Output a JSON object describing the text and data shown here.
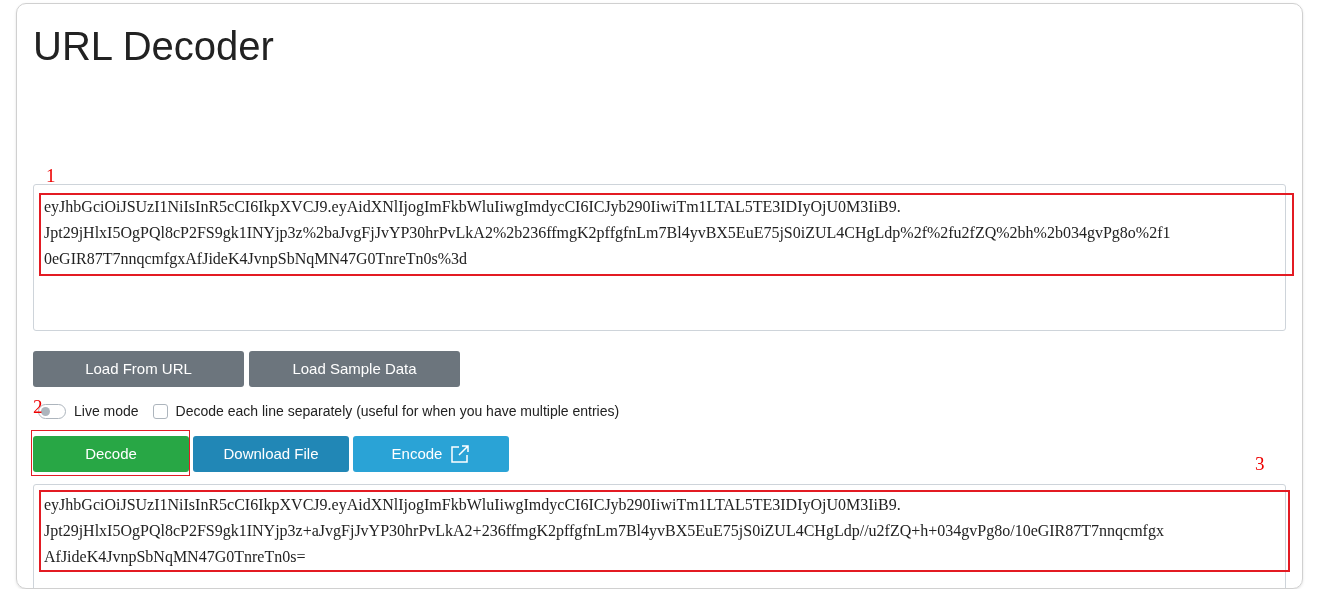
{
  "title": "URL Decoder",
  "input": {
    "lines": [
      "eyJhbGciOiJSUzI1NiIsInR5cCI6IkpXVCJ9.eyAidXNlIjogImFkbWluIiwgImdycCI6ICJyb290IiwiTm1LTAL5TE3IDIyOjU0M3IiB9.",
      "Jpt29jHlxI5OgPQl8cP2FS9gk1INYjp3z%2baJvgFjJvYP30hrPvLkA2%2b236ffmgK2pffgfnLm7Bl4yvBX5EuE75jS0iZUL4CHgLdp%2f%2fu2fZQ%2bh%2b034gvPg8o%2f1",
      "0eGIR87T7nnqcmfgxAfJideK4JvnpSbNqMN47G0TnreTn0s%3d"
    ],
    "annotation": "1"
  },
  "load_buttons": [
    "Load From URL",
    "Load Sample Data"
  ],
  "options": [
    {
      "kind": "toggle",
      "label": "Live mode",
      "on": false,
      "annotation": "2"
    },
    {
      "kind": "checkbox",
      "label": "Decode each line separately (useful for when you have multiple entries)",
      "checked": false
    }
  ],
  "action_buttons": [
    {
      "kind": "decode",
      "label": "Decode",
      "annotated": true
    },
    {
      "kind": "download",
      "label": "Download File",
      "annotated": false
    },
    {
      "kind": "encode",
      "label": "Encode",
      "annotated": false
    }
  ],
  "output": {
    "lines": [
      "eyJhbGciOiJSUzI1NiIsInR5cCI6IkpXVCJ9.eyAidXNlIjogImFkbWluIiwgImdycCI6ICJyb290IiwiTm1LTAL5TE3IDIyOjU0M3IiB9.",
      "Jpt29jHlxI5OgPQl8cP2FS9gk1INYjp3z+aJvgFjJvYP30hrPvLkA2+236ffmgK2pffgfnLm7Bl4yvBX5EuE75jS0iZUL4CHgLdp//u2fZQ+h+034gvPg8o/10eGIR87T7nnqcmfgx",
      "AfJideK4JvnpSbNqMN47G0TnreTn0s="
    ],
    "annotation": "3"
  }
}
